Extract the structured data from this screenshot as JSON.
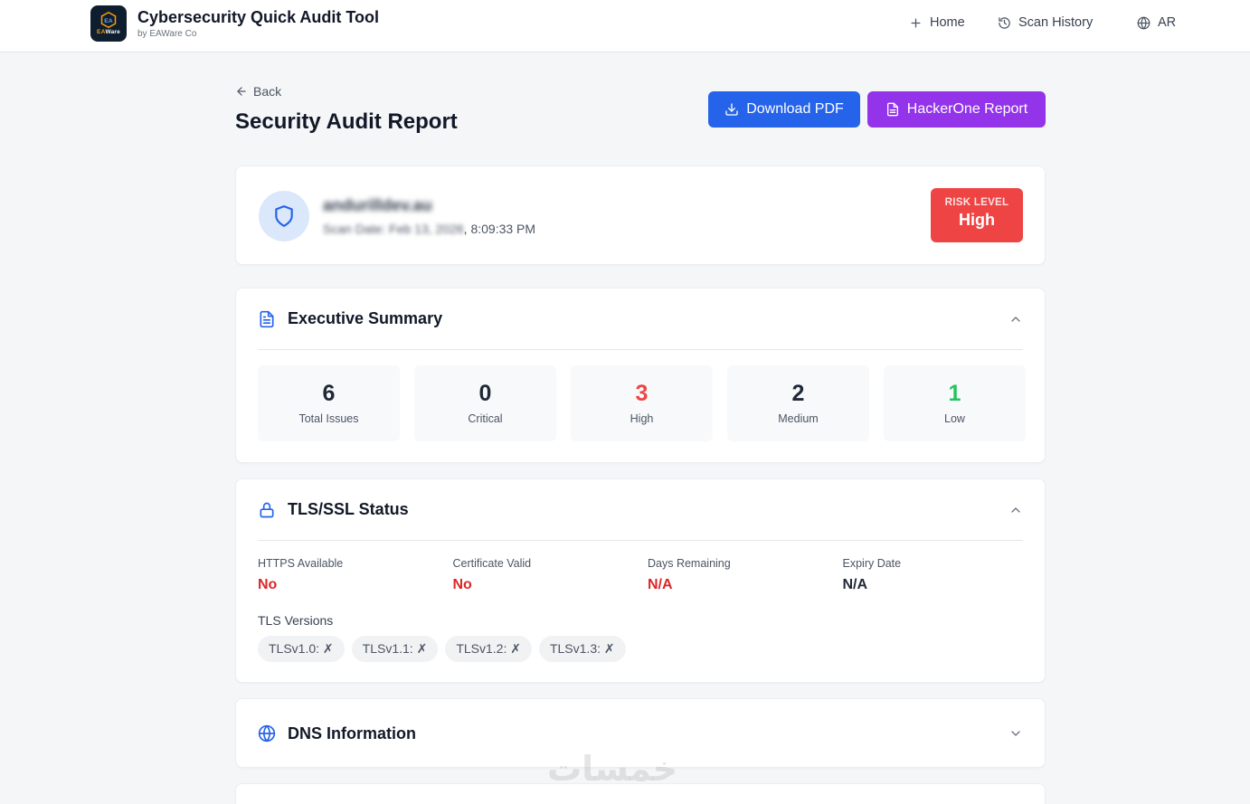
{
  "header": {
    "logo_text_ea": "EA",
    "logo_text_ware": "Ware",
    "title": "Cybersecurity Quick Audit Tool",
    "subtitle": "by EAWare Co",
    "nav": {
      "home": "Home",
      "scan_history": "Scan History",
      "language": "AR"
    }
  },
  "page": {
    "back_label": "Back",
    "title": "Security Audit Report",
    "download_pdf_label": "Download PDF",
    "hackerone_label": "HackerOne Report"
  },
  "target": {
    "domain": "andurilldev.au",
    "scan_date_prefix": "Scan Date: Feb 13, 2026",
    "scan_date_suffix": ", 8:09:33 PM",
    "risk_label": "RISK LEVEL",
    "risk_value": "High"
  },
  "summary": {
    "title": "Executive Summary",
    "stats": [
      {
        "value": "6",
        "label": "Total Issues",
        "color": "#1f2937"
      },
      {
        "value": "0",
        "label": "Critical",
        "color": "#1f2937"
      },
      {
        "value": "3",
        "label": "High",
        "color": "#ef4444"
      },
      {
        "value": "2",
        "label": "Medium",
        "color": "#1f2937"
      },
      {
        "value": "1",
        "label": "Low",
        "color": "#22c55e"
      }
    ]
  },
  "tls": {
    "title": "TLS/SSL Status",
    "fields": [
      {
        "label": "HTTPS Available",
        "value": "No"
      },
      {
        "label": "Certificate Valid",
        "value": "No"
      },
      {
        "label": "Days Remaining",
        "value": "N/A"
      },
      {
        "label": "Expiry Date",
        "value": "N/A"
      }
    ],
    "versions_label": "TLS Versions",
    "versions": [
      "TLSv1.0: ✗",
      "TLSv1.1: ✗",
      "TLSv1.2: ✗",
      "TLSv1.3: ✗"
    ]
  },
  "dns": {
    "title": "DNS Information"
  },
  "colors": {
    "primary": "#2563eb",
    "purple": "#9333ea",
    "danger": "#ef4444",
    "success": "#22c55e"
  },
  "watermark": "خمسات"
}
